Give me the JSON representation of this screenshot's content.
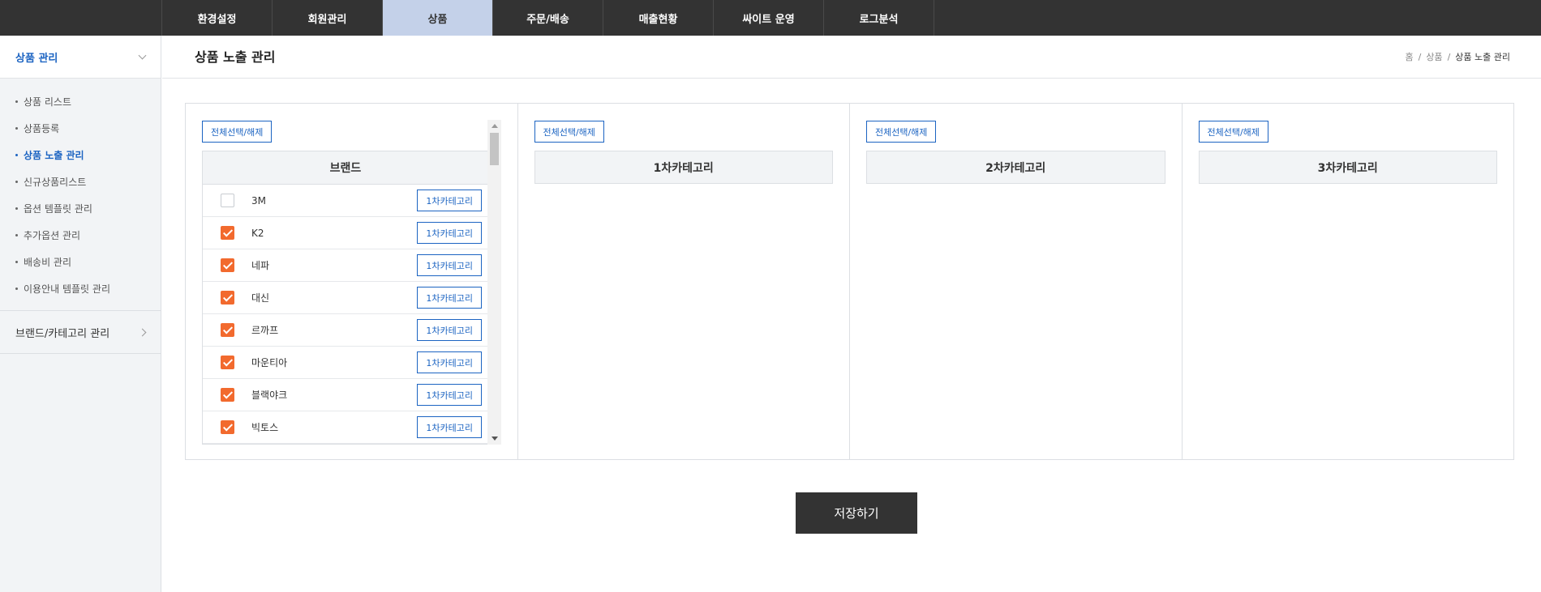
{
  "topnav": {
    "tabs": [
      {
        "label": "환경설정"
      },
      {
        "label": "회원관리"
      },
      {
        "label": "상품"
      },
      {
        "label": "주문/배송"
      },
      {
        "label": "매출현황"
      },
      {
        "label": "싸이트 운영"
      },
      {
        "label": "로그분석"
      }
    ],
    "active_index": 2
  },
  "sidebar": {
    "section_title": "상품 관리",
    "items": [
      {
        "label": "상품 리스트"
      },
      {
        "label": "상품등록"
      },
      {
        "label": "상품 노출 관리"
      },
      {
        "label": "신규상품리스트"
      },
      {
        "label": "옵션 템플릿 관리"
      },
      {
        "label": "추가옵션 관리"
      },
      {
        "label": "배송비 관리"
      },
      {
        "label": "이용안내 템플릿 관리"
      }
    ],
    "active_index": 2,
    "group_label": "브랜드/카테고리 관리"
  },
  "header": {
    "title": "상품 노출 관리",
    "breadcrumb": {
      "home": "홈",
      "sep": "/",
      "section": "상품",
      "current": "상품 노출 관리"
    }
  },
  "panels": [
    {
      "select_all": "전체선택/해제",
      "heading": "브랜드"
    },
    {
      "select_all": "전체선택/해제",
      "heading": "1차카테고리"
    },
    {
      "select_all": "전체선택/해제",
      "heading": "2차카테고리"
    },
    {
      "select_all": "전체선택/해제",
      "heading": "3차카테고리"
    }
  ],
  "brands": [
    {
      "name": "3M",
      "checked": false,
      "button": "1차카테고리"
    },
    {
      "name": "K2",
      "checked": true,
      "button": "1차카테고리"
    },
    {
      "name": "네파",
      "checked": true,
      "button": "1차카테고리"
    },
    {
      "name": "대신",
      "checked": true,
      "button": "1차카테고리"
    },
    {
      "name": "르까프",
      "checked": true,
      "button": "1차카테고리"
    },
    {
      "name": "마운티아",
      "checked": true,
      "button": "1차카테고리"
    },
    {
      "name": "블랙야크",
      "checked": true,
      "button": "1차카테고리"
    },
    {
      "name": "빅토스",
      "checked": true,
      "button": "1차카테고리"
    }
  ],
  "save_label": "저장하기"
}
